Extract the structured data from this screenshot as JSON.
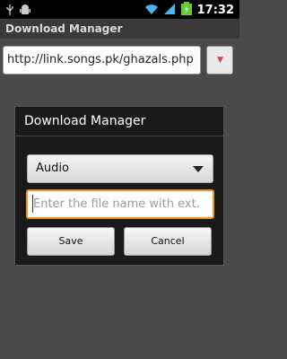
{
  "status_bar": {
    "time": "17:32",
    "icons": [
      "usb-icon",
      "android-icon",
      "wifi-icon",
      "signal-icon",
      "battery-icon"
    ]
  },
  "app": {
    "title": "Download Manager"
  },
  "url_bar": {
    "value": "http://link.songs.pk/ghazals.php",
    "button_icon": "download-arrow-icon"
  },
  "dialog": {
    "title": "Download Manager",
    "type_select": {
      "selected": "Audio"
    },
    "filename_input": {
      "placeholder": "Enter the file name with ext.",
      "value": ""
    },
    "save_label": "Save",
    "cancel_label": "Cancel"
  },
  "colors": {
    "focus_border": "#f29418",
    "dialog_bg": "#1a1a1a",
    "page_bg": "#4a4a4a"
  }
}
